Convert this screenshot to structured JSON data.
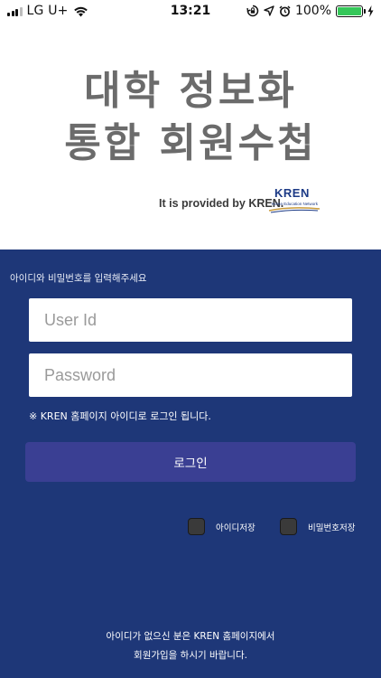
{
  "status_bar": {
    "carrier": "LG U+",
    "time": "13:21",
    "battery_percent": "100%",
    "battery_level": 1.0,
    "battery_color": "#35c759",
    "icons": [
      "signal-icon",
      "wifi-icon",
      "screen-rotation-lock-icon",
      "location-icon",
      "alarm-icon",
      "battery-icon",
      "charging-bolt-icon"
    ]
  },
  "header": {
    "title_line1": "대학 정보화",
    "title_line2": "통합 회원수첩",
    "provided_by": "It is provided by KREN.",
    "logo_text": "KREN",
    "logo_subtext": "Korea Education Network"
  },
  "login": {
    "prompt": "아이디와 비밀번호를 입력해주세요",
    "user_id_placeholder": "User Id",
    "password_placeholder": "Password",
    "note": "※ KREN 홈페이지 아이디로 로그인 됩니다.",
    "login_button": "로그인",
    "save_id_label": "아이디저장",
    "save_password_label": "비밀번호저장"
  },
  "footer": {
    "line1": "아이디가 없으신 분은 KREN 홈페이지에서",
    "line2": "회원가입을 하시기 바랍니다."
  },
  "colors": {
    "panel_background": "#1e3778",
    "login_button": "#3a3f93",
    "title_gray": "#6b6b6b",
    "logo_blue": "#1c3a86"
  }
}
